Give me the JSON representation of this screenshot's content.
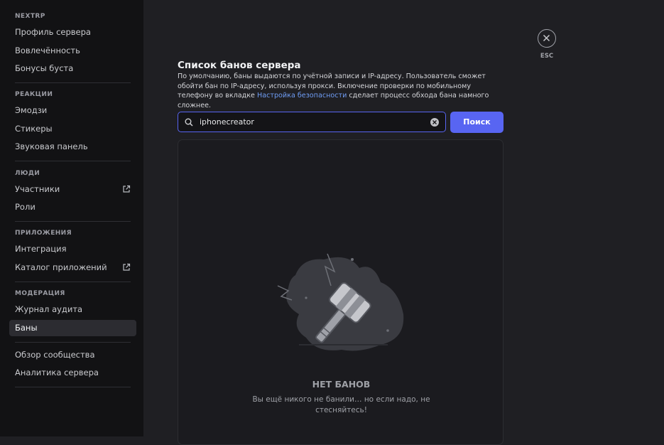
{
  "sidebar": {
    "sections": [
      {
        "header": "NEXTRP",
        "items": [
          "Профиль сервера",
          "Вовлечённость",
          "Бонусы буста"
        ]
      },
      {
        "header": "РЕАКЦИИ",
        "items": [
          "Эмодзи",
          "Стикеры",
          "Звуковая панель"
        ]
      },
      {
        "header": "ЛЮДИ",
        "items": [
          "Участники",
          "Роли"
        ]
      },
      {
        "header": "ПРИЛОЖЕНИЯ",
        "items": [
          "Интеграция",
          "Каталог приложений"
        ]
      },
      {
        "header": "МОДЕРАЦИЯ",
        "items": [
          "Журнал аудита",
          "Баны"
        ]
      },
      {
        "header": "",
        "items": [
          "Обзор сообщества",
          "Аналитика сервера"
        ]
      }
    ],
    "selected": "Баны"
  },
  "close": {
    "label": "ESC"
  },
  "main": {
    "title": "Список банов сервера",
    "description_part1": "По умолчанию, баны выдаются по учётной записи и IP-адресу. Пользователь сможет обойти бан по IP-адресу, используя прокси. Включение проверки по мобильному телефону во вкладке ",
    "description_link": "Настройка безопасности",
    "description_part2": " сделает процесс обхода бана намного сложнее.",
    "search_value": "iphonecreator",
    "search_button": "Поиск",
    "empty_title": "НЕТ БАНОВ",
    "empty_text": "Вы ещё никого не банили… но если надо, не стесняйтесь!"
  },
  "colors": {
    "accent": "#5865f2",
    "link": "#6f9df5",
    "sidebar_bg": "#121214",
    "content_bg": "#1f1f23"
  }
}
